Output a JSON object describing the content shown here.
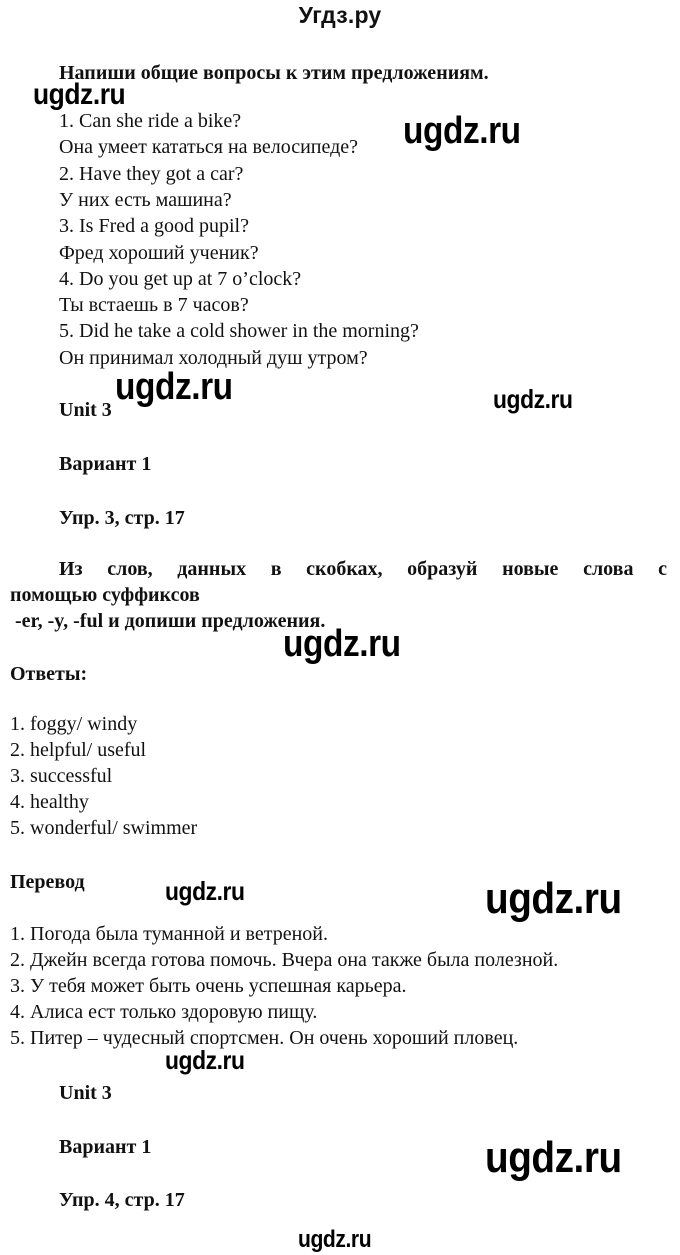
{
  "site_title": "Угдз.ру",
  "section1": {
    "instruction": "Напиши общие вопросы к этим предложениям.",
    "items": [
      "1. Can she ride a bike?",
      "Она умеет кататься на велосипеде?",
      "2. Have they got a car?",
      "У них есть машина?",
      "3. Is Fred a good pupil?",
      "Фред хороший ученик?",
      "4. Do you get up at 7 o’clock?",
      "Ты встаешь в 7 часов?",
      "5. Did he take a cold shower in the morning?",
      "Он принимал холодный душ утром?"
    ]
  },
  "section2": {
    "unit": "Unit 3",
    "variant": "Вариант 1",
    "exercise": "Упр. 3, стр. 17",
    "instruction_line1": "Из слов, данных в скобках, образуй новые слова с",
    "instruction_line2": "помощью суффиксов",
    "instruction_line3": " -er, -y, -ful и допиши предложения.",
    "answers_label": "Ответы:",
    "answers": [
      "1. foggy/ windy",
      "2. helpful/ useful",
      "3. successful",
      "4. healthy",
      "5. wonderful/ swimmer"
    ],
    "translation_label": "Перевод",
    "translations": [
      "1. Погода была туманной и ветреной.",
      "2. Джейн всегда готова помочь. Вчера она также была полезной.",
      "3. У тебя может быть очень успешная карьера.",
      "4. Алиса ест только здоровую пищу.",
      "5. Питер – чудесный спортсмен. Он очень хороший пловец."
    ]
  },
  "section3": {
    "unit": "Unit 3",
    "variant": "Вариант 1",
    "exercise": "Упр. 4, стр. 17"
  },
  "watermarks": {
    "text": "ugdz.ru"
  }
}
